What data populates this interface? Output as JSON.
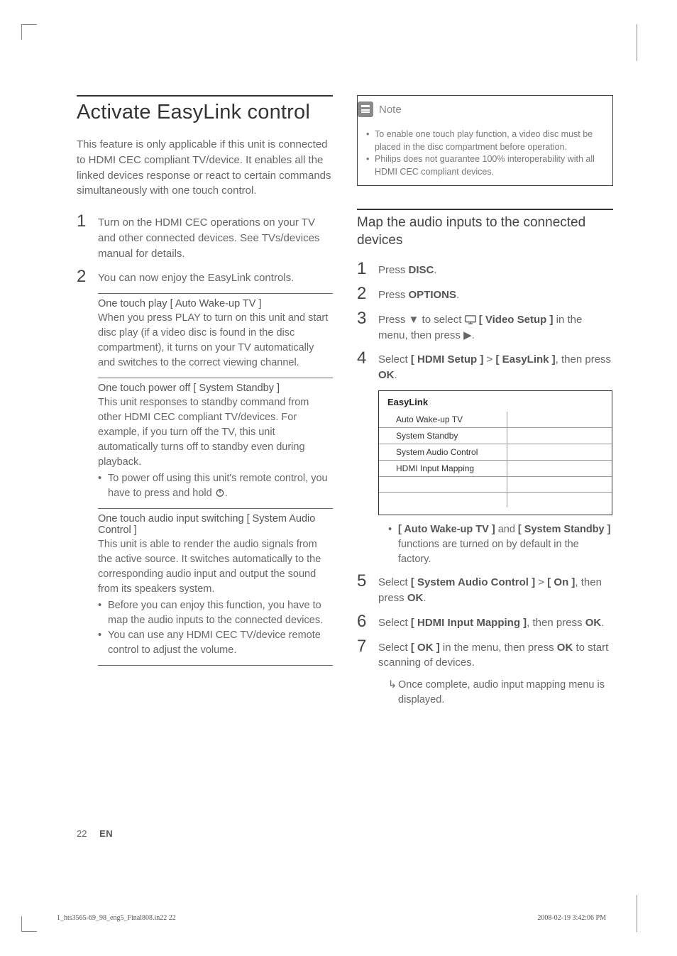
{
  "left": {
    "heading": "Activate EasyLink control",
    "intro": "This feature is only applicable if this unit is connected to HDMI CEC compliant TV/device. It enables all the linked devices response or react to certain commands simultaneously with one touch control.",
    "step1": "Turn on the HDMI CEC operations on your TV and other connected devices. See TVs/devices manual for details.",
    "step2": "You can now enjoy the EasyLink controls.",
    "sub1_title": "One touch play [ Auto Wake-up TV ]",
    "sub1_body": "When you press PLAY to turn on this unit and start disc play (if a video disc is found in the disc compartment), it turns on your TV automatically and switches to the correct viewing channel.",
    "sub2_title": "One touch power off [ System Standby ]",
    "sub2_body": "This unit responses to standby command from other HDMI CEC compliant TV/devices.  For example, if you turn off the TV, this unit automatically turns off to standby even during playback.",
    "sub2_bullet": "To power off using this unit's remote control, you have to press and hold ",
    "sub3_title": "One touch audio input switching [ System Audio Control ]",
    "sub3_body": "This unit is able to render the audio signals from the active source.  It switches automatically to the corresponding audio input and output the sound from its speakers system.",
    "sub3_b1": "Before you can enjoy this function, you have to map the audio inputs to the connected devices.",
    "sub3_b2": "You can use any HDMI CEC TV/device remote control to adjust the volume."
  },
  "right": {
    "note_label": "Note",
    "note_b1": "To enable one touch play function, a video disc must be placed in the disc compartment before operation.",
    "note_b2": "Philips does not guarantee 100% interoperability with all HDMI CEC compliant devices.",
    "heading2": "Map the audio inputs to the connected devices",
    "r1_a": "Press ",
    "r1_b": "DISC",
    "r1_c": ".",
    "r2_a": "Press ",
    "r2_b": "OPTIONS",
    "r2_c": ".",
    "r3_a": "Press ▼ to select ",
    "r3_b": "[ Video Setup ]",
    "r3_c": " in the menu, then press ▶.",
    "r4_a": "Select ",
    "r4_b": "[ HDMI Setup ]",
    "r4_c": " > ",
    "r4_d": "[ EasyLink ]",
    "r4_e": ", then press ",
    "r4_f": "OK",
    "r4_g": ".",
    "menu_title": "EasyLink",
    "menu_items": [
      "Auto Wake-up TV",
      "System Standby",
      "System Audio Control",
      "HDMI Input Mapping"
    ],
    "r4_sub_a": "[ Auto Wake-up TV ]",
    "r4_sub_b": " and ",
    "r4_sub_c": "[ System Standby ]",
    "r4_sub_d": " functions are turned on by default in the factory.",
    "r5_a": "Select ",
    "r5_b": "[ System Audio Control ]",
    "r5_c": " > ",
    "r5_d": "[ On ]",
    "r5_e": ", then press ",
    "r5_f": "OK",
    "r5_g": ".",
    "r6_a": "Select ",
    "r6_b": "[ HDMI Input Mapping ]",
    "r6_c": ", then press ",
    "r6_d": "OK",
    "r6_e": ".",
    "r7_a": "Select ",
    "r7_b": "[ OK ]",
    "r7_c": " in the menu, then press ",
    "r7_d": "OK",
    "r7_e": " to start scanning of devices.",
    "r7_sub": "Once complete, audio input mapping menu is displayed."
  },
  "footer": {
    "pagenum": "22",
    "lang": "EN",
    "printleft": "1_hts3565-69_98_eng5_Final808.in22   22",
    "printright": "2008-02-19   3:42:06 PM"
  }
}
